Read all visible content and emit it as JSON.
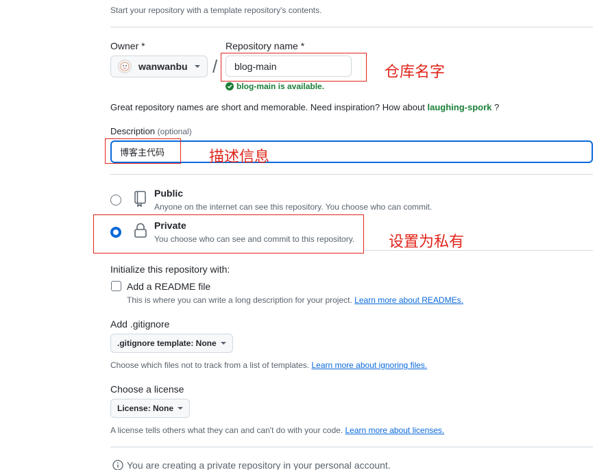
{
  "template_hint": "Start your repository with a template repository's contents.",
  "owner": {
    "label": "Owner *",
    "value": "wanwanbu"
  },
  "repo": {
    "label": "Repository name *",
    "value": "blog-main",
    "available_msg": "blog-main is available."
  },
  "inspiration": {
    "text": "Great repository names are short and memorable. Need inspiration? How about",
    "suggestion": "laughing-spork",
    "suffix": "?"
  },
  "description": {
    "label": "Description",
    "optional": "(optional)",
    "value": "博客主代码"
  },
  "visibility": {
    "public": {
      "title": "Public",
      "desc": "Anyone on the internet can see this repository. You choose who can commit."
    },
    "private": {
      "title": "Private",
      "desc": "You choose who can see and commit to this repository."
    },
    "selected": "private"
  },
  "init": {
    "heading": "Initialize this repository with:",
    "readme_label": "Add a README file",
    "readme_desc": "This is where you can write a long description for your project.",
    "readme_link": "Learn more about READMEs."
  },
  "gitignore": {
    "heading": "Add .gitignore",
    "button": ".gitignore template: None",
    "desc": "Choose which files not to track from a list of templates.",
    "link": "Learn more about ignoring files."
  },
  "license": {
    "heading": "Choose a license",
    "button": "License: None",
    "desc": "A license tells others what they can and can't do with your code.",
    "link": "Learn more about licenses."
  },
  "notice": "You are creating a private repository in your personal account.",
  "annotations": {
    "repo_name": "仓库名字",
    "description": "描述信息",
    "private": "设置为私有"
  },
  "colors": {
    "accent": "#0969da",
    "success": "#1a7f37",
    "annotation": "#e0251b"
  }
}
